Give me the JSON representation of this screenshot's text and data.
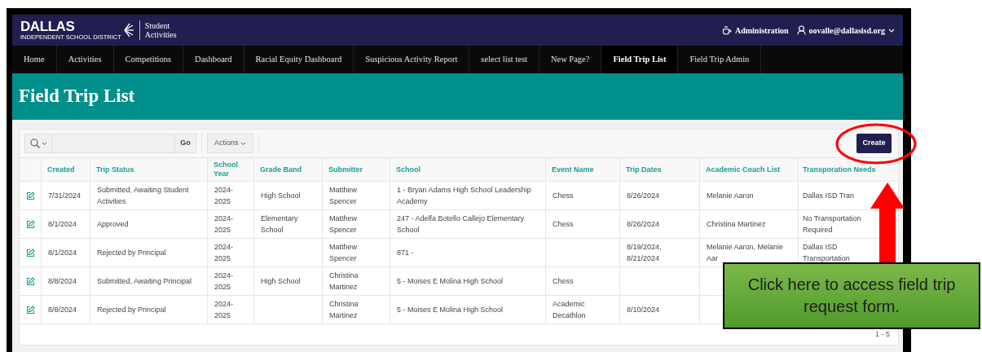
{
  "header": {
    "logo": {
      "wordmark": "DALLAS",
      "subtitle": "INDEPENDENT SCHOOL DISTRICT"
    },
    "app_name": "Student Activities",
    "admin_link": "Administration",
    "user_menu": "oovalle@dallasisd.org"
  },
  "nav": [
    {
      "label": "Home",
      "selected": false
    },
    {
      "label": "Activities",
      "selected": false
    },
    {
      "label": "Competitions",
      "selected": false
    },
    {
      "label": "Dashboard",
      "selected": false
    },
    {
      "label": "Racial Equity Dashboard",
      "selected": false
    },
    {
      "label": "Suspicious Activity Report",
      "selected": false
    },
    {
      "label": "select list test",
      "selected": false
    },
    {
      "label": "New Page?",
      "selected": false
    },
    {
      "label": "Field Trip List",
      "selected": true
    },
    {
      "label": "Field Trip Admin",
      "selected": false
    }
  ],
  "page_title": "Field Trip List",
  "toolbar": {
    "go_button": "Go",
    "actions_menu": "Actions",
    "create_button": "Create"
  },
  "table": {
    "columns": [
      "Created",
      "Trip Status",
      "School Year",
      "Grade Band",
      "Submitter",
      "School",
      "Event Name",
      "Trip Dates",
      "Academic Coach List",
      "Transporation Needs"
    ],
    "rows": [
      {
        "cells": [
          "7/31/2024",
          "Submitted, Awaiting Student Activities",
          "2024-2025",
          "High School",
          "Matthew Spencer",
          "1 - Bryan Adams High School Leadership Academy",
          "Chess",
          "8/26/2024",
          "Melanie Aaron",
          "Dallas ISD Tran"
        ]
      },
      {
        "cells": [
          "8/1/2024",
          "Approved",
          "2024-2025",
          "Elementary School",
          "Matthew Spencer",
          "247 - Adelfa Botello Callejo Elementary School",
          "Chess",
          "8/26/2024",
          "Christina Martinez",
          "No Transportation Required"
        ]
      },
      {
        "cells": [
          "8/1/2024",
          "Rejected by Principal",
          "2024-2025",
          null,
          "Matthew Spencer",
          "871 -",
          null,
          "8/19/2024, 8/21/2024",
          "Melanie Aaron, Melanie Aar",
          "Dallas ISD Transportation"
        ]
      },
      {
        "cells": [
          "8/8/2024",
          "Submitted, Awaiting Principal",
          "2024-2025",
          "High School",
          "Christina Martinez",
          "5 - Moises E Molina High School",
          "Chess"
        ]
      },
      {
        "cells": [
          "8/8/2024",
          "Rejected by Principal",
          "2024-2025",
          null,
          "Christina Martinez",
          "5 - Moises E Molina High School",
          "Academic Decathlon",
          "8/10/2024"
        ]
      }
    ],
    "pagination": "1 - 5"
  },
  "annotation": {
    "callout": "Click here to access field trip request form."
  }
}
